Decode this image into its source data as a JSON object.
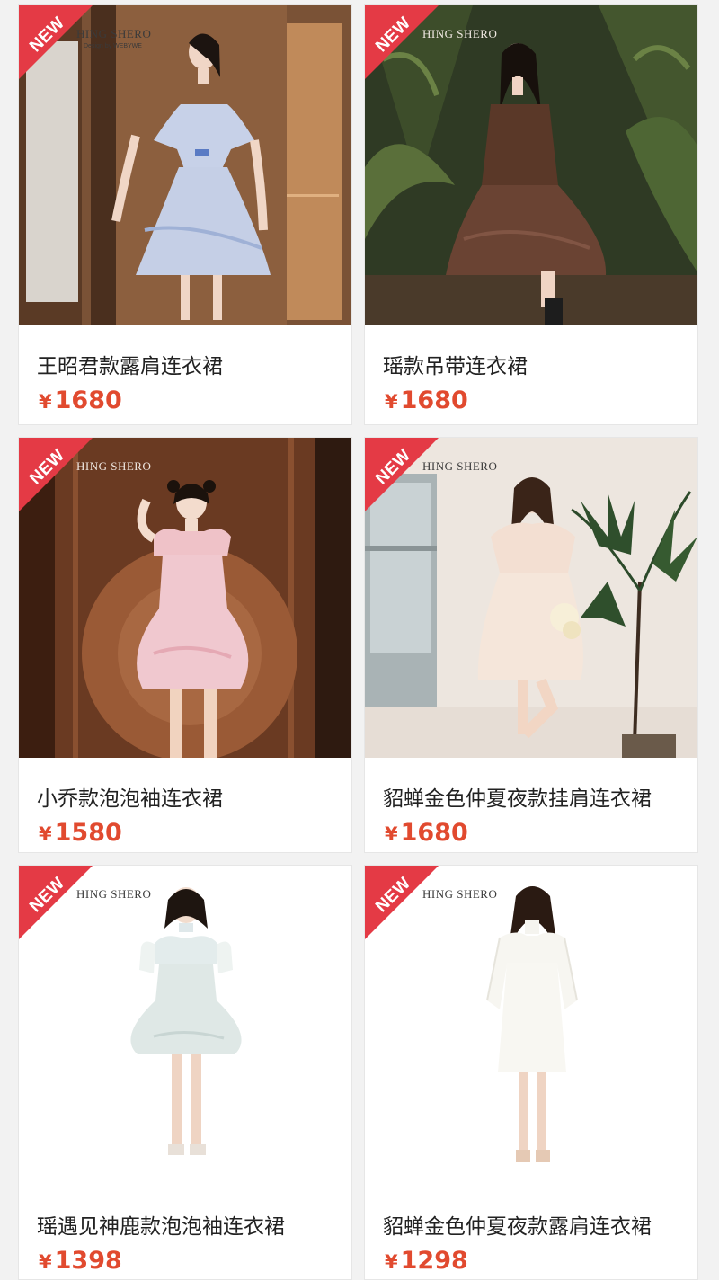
{
  "products": [
    {
      "badge": "NEW",
      "brand": "HING SHERO",
      "brand_sub": "Design by WEBYWE",
      "name": "王昭君款露肩连衣裙",
      "currency": "¥",
      "price": "1680",
      "accent": "#e14a2f"
    },
    {
      "badge": "NEW",
      "brand": "HING SHERO",
      "brand_sub": "",
      "name": "瑶款吊带连衣裙",
      "currency": "¥",
      "price": "1680",
      "accent": "#e14a2f"
    },
    {
      "badge": "NEW",
      "brand": "HING SHERO",
      "brand_sub": "",
      "name": "小乔款泡泡袖连衣裙",
      "currency": "¥",
      "price": "1580",
      "accent": "#e14a2f"
    },
    {
      "badge": "NEW",
      "brand": "HING SHERO",
      "brand_sub": "",
      "name": "貂蝉金色仲夏夜款挂肩连衣裙",
      "currency": "¥",
      "price": "1680",
      "accent": "#e14a2f"
    },
    {
      "badge": "NEW",
      "brand": "HING SHERO",
      "brand_sub": "",
      "name": "瑶遇见神鹿款泡泡袖连衣裙",
      "currency": "¥",
      "price": "1398",
      "accent": "#e14a2f"
    },
    {
      "badge": "NEW",
      "brand": "HING SHERO",
      "brand_sub": "",
      "name": "貂蝉金色仲夏夜款露肩连衣裙",
      "currency": "¥",
      "price": "1298",
      "accent": "#e14a2f"
    }
  ],
  "colors": {
    "badge_red": "#e43a45",
    "price_red": "#e14a2f",
    "page_bg": "#f2f2f2"
  }
}
